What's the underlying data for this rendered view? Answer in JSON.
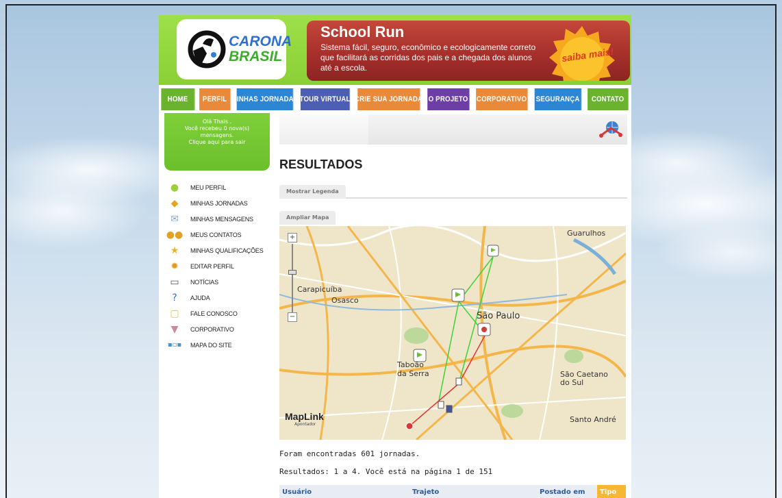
{
  "header": {
    "logo": {
      "line1": "CARONA",
      "line2": "BRASIL"
    },
    "banner": {
      "title": "School Run",
      "text": "Sistema fácil, seguro, econômico e ecologicamente correto que facilitará as corridas dos pais e a chegada dos alunos até a escola.",
      "cta": "saiba mais!"
    }
  },
  "nav": [
    {
      "label": "HOME",
      "color": "#6bb32f"
    },
    {
      "label": "PERFIL",
      "color": "#e98a3a"
    },
    {
      "label": "MINHAS JORNADAS",
      "color": "#2d86d3"
    },
    {
      "label": "TOUR VIRTUAL",
      "color": "#4c5fb3"
    },
    {
      "label": "CRIE SUA JORNADA",
      "color": "#e98a3a"
    },
    {
      "label": "O PROJETO",
      "color": "#6d3fa6"
    },
    {
      "label": "CORPORATIVO",
      "color": "#e98a3a"
    },
    {
      "label": "SEGURANÇA",
      "color": "#2d86d3"
    },
    {
      "label": "CONTATO",
      "color": "#6bb32f"
    }
  ],
  "user_box": {
    "greeting": "Olá Thais .",
    "messages": "Você recebeu 0 nova(s)",
    "messages2": "mensagens.",
    "logout": "Clique aqui para sair"
  },
  "menu": [
    {
      "label": "MEU PERFIL",
      "icon": "person-icon"
    },
    {
      "label": "MINHAS JORNADAS",
      "icon": "road-sign-icon"
    },
    {
      "label": "MINHAS MENSAGENS",
      "icon": "mail-icon"
    },
    {
      "label": "MEUS CONTATOS",
      "icon": "contacts-icon"
    },
    {
      "label": "MINHAS QUALIFICAÇÕES",
      "icon": "star-icon"
    },
    {
      "label": "EDITAR PERFIL",
      "icon": "gear-icon"
    },
    {
      "label": "NOTÍCIAS",
      "icon": "news-icon"
    },
    {
      "label": "AJUDA",
      "icon": "help-icon"
    },
    {
      "label": "FALE CONOSCO",
      "icon": "chat-icon"
    },
    {
      "label": "CORPORATIVO",
      "icon": "tie-icon"
    },
    {
      "label": "MAPA DO SITE",
      "icon": "sitemap-icon"
    }
  ],
  "main": {
    "title": "RESULTADOS",
    "legend_tab": "Mostrar Legenda",
    "map_tab": "Ampliar Mapa",
    "map": {
      "places": [
        "Guarulhos",
        "Carapicuíba",
        "Osasco",
        "São Paulo",
        "Taboão",
        "da Serra",
        "São Caetano",
        "do Sul",
        "Santo André"
      ],
      "brand": "MapLink",
      "brand_sub": "Apontador",
      "zoom_in": "+",
      "zoom_out": "−"
    },
    "found": "Foram encontradas 601 jornadas.",
    "pagination": "Resultados: 1 a 4. Você está na página 1 de 151",
    "table_headers": {
      "usuario": "Usuário",
      "trajeto": "Trajeto",
      "postado": "Postado em",
      "tipo": "Tipo"
    }
  }
}
